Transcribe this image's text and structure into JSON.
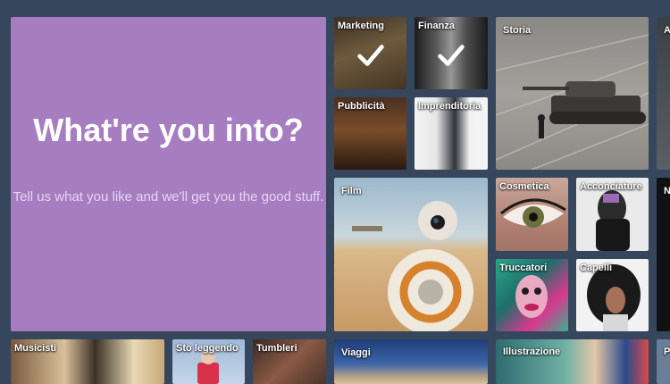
{
  "hero": {
    "title": "What're you into?",
    "subtitle": "Tell us what you like and we'll get you the good stuff."
  },
  "tiles": {
    "marketing": {
      "label": "Marketing",
      "selected": true
    },
    "finanza": {
      "label": "Finanza",
      "selected": true
    },
    "storia": {
      "label": "Storia"
    },
    "partial_a": {
      "label": "A"
    },
    "pubblicita": {
      "label": "Pubblicità"
    },
    "imprenditoria": {
      "label": "Imprenditoria"
    },
    "film": {
      "label": "Film"
    },
    "cosmetica": {
      "label": "Cosmetica"
    },
    "acconciature": {
      "label": "Acconciature"
    },
    "partial_n": {
      "label": "N"
    },
    "truccatori": {
      "label": "Truccatori"
    },
    "capelli": {
      "label": "Capelli"
    },
    "musicisti": {
      "label": "Musicisti"
    },
    "sto_leggendo": {
      "label": "Sto leggendo"
    },
    "tumbleri": {
      "label": "Tumbleri"
    },
    "viaggi": {
      "label": "Viaggi"
    },
    "illustrazione": {
      "label": "Illustrazione"
    },
    "partial_p": {
      "label": "P"
    }
  },
  "colors": {
    "background": "#36465d",
    "hero": "#a77dc2"
  }
}
